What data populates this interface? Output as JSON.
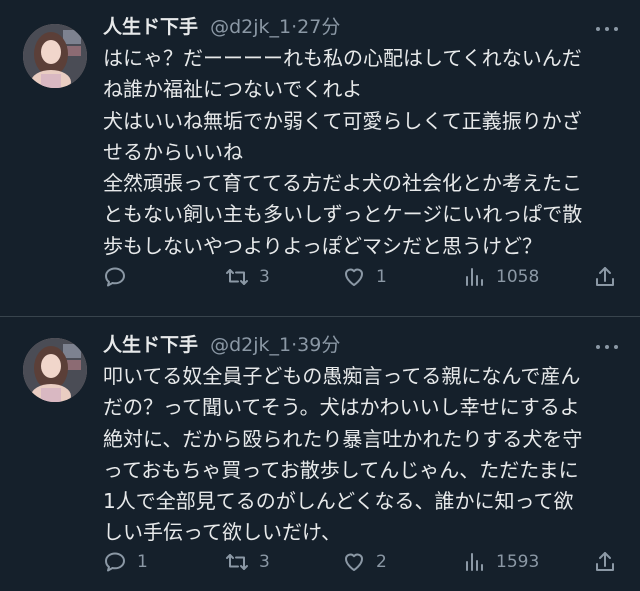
{
  "tweets": [
    {
      "name": "人生ド下手",
      "handle": "@d2jk_1",
      "dot": "·",
      "time": "27分",
      "lines": [
        "はにゃ？だーーーーれも私の心配はしてくれないんだ",
        "ね誰か福祉につないでくれよ",
        "犬はいいね無垢でか弱くて可愛らしくて正義振りかざ",
        "せるからいいね",
        "全然頑張って育ててる方だよ犬の社会化とか考えたこ",
        "ともない飼い主も多いしずっとケージにいれっぱで散",
        "歩もしないやつよりよっぽどマシだと思うけど？"
      ],
      "stats": {
        "replies": "",
        "retweets": "3",
        "likes": "1",
        "views": "1058"
      }
    },
    {
      "name": "人生ド下手",
      "handle": "@d2jk_1",
      "dot": "·",
      "time": "39分",
      "lines": [
        "叩いてる奴全員子どもの愚痴言ってる親になんで産ん",
        "だの？って聞いてそう。犬はかわいいし幸せにするよ",
        "絶対に、だから殴られたり暴言吐かれたりする犬を守",
        "っておもちゃ買ってお散歩してんじゃん、ただたまに",
        "1人で全部見てるのがしんどくなる、誰かに知って欲",
        "しい手伝って欲しいだけ、"
      ],
      "stats": {
        "replies": "1",
        "retweets": "3",
        "likes": "2",
        "views": "1593"
      }
    }
  ],
  "icons": {
    "reply": "reply-icon",
    "retweet": "retweet-icon",
    "like": "heart-icon",
    "views": "views-chart-icon",
    "share": "share-icon",
    "more": "more-options-icon"
  },
  "colors": {
    "background": "#15202b",
    "text": "#e7e9ea",
    "secondary": "#8b98a5",
    "divider": "#38444d"
  }
}
